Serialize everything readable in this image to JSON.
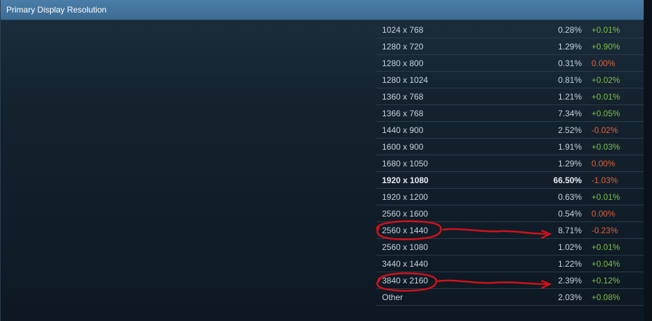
{
  "header": {
    "title": "Primary Display Resolution"
  },
  "rows": [
    {
      "resolution": "1024 x 768",
      "percent": "0.28%",
      "change": "+0.01%",
      "trend": "up"
    },
    {
      "resolution": "1280 x 720",
      "percent": "1.29%",
      "change": "+0.90%",
      "trend": "up"
    },
    {
      "resolution": "1280 x 800",
      "percent": "0.31%",
      "change": "0.00%",
      "trend": "down"
    },
    {
      "resolution": "1280 x 1024",
      "percent": "0.81%",
      "change": "+0.02%",
      "trend": "up"
    },
    {
      "resolution": "1360 x 768",
      "percent": "1.21%",
      "change": "+0.01%",
      "trend": "up"
    },
    {
      "resolution": "1366 x 768",
      "percent": "7.34%",
      "change": "+0.05%",
      "trend": "up"
    },
    {
      "resolution": "1440 x 900",
      "percent": "2.52%",
      "change": "-0.02%",
      "trend": "down"
    },
    {
      "resolution": "1600 x 900",
      "percent": "1.91%",
      "change": "+0.03%",
      "trend": "up"
    },
    {
      "resolution": "1680 x 1050",
      "percent": "1.29%",
      "change": "0.00%",
      "trend": "down"
    },
    {
      "resolution": "1920 x 1080",
      "percent": "66.50%",
      "change": "-1.03%",
      "trend": "down",
      "highlight": true
    },
    {
      "resolution": "1920 x 1200",
      "percent": "0.63%",
      "change": "+0.01%",
      "trend": "up"
    },
    {
      "resolution": "2560 x 1600",
      "percent": "0.54%",
      "change": "0.00%",
      "trend": "down"
    },
    {
      "resolution": "2560 x 1440",
      "percent": "8.71%",
      "change": "-0.23%",
      "trend": "down"
    },
    {
      "resolution": "2560 x 1080",
      "percent": "1.02%",
      "change": "+0.01%",
      "trend": "up"
    },
    {
      "resolution": "3440 x 1440",
      "percent": "1.22%",
      "change": "+0.04%",
      "trend": "up"
    },
    {
      "resolution": "3840 x 2160",
      "percent": "2.39%",
      "change": "+0.12%",
      "trend": "up"
    },
    {
      "resolution": "Other",
      "percent": "2.03%",
      "change": "+0.08%",
      "trend": "up"
    }
  ],
  "colors": {
    "header": "#3f729c",
    "positive": "#7bc142",
    "negative": "#e0603a",
    "annotation": "#d0121b"
  },
  "annotations": [
    {
      "label": "circle-and-arrow",
      "resolution": "2560 x 1440"
    },
    {
      "label": "circle-and-arrow",
      "resolution": "3840 x 2160"
    }
  ]
}
